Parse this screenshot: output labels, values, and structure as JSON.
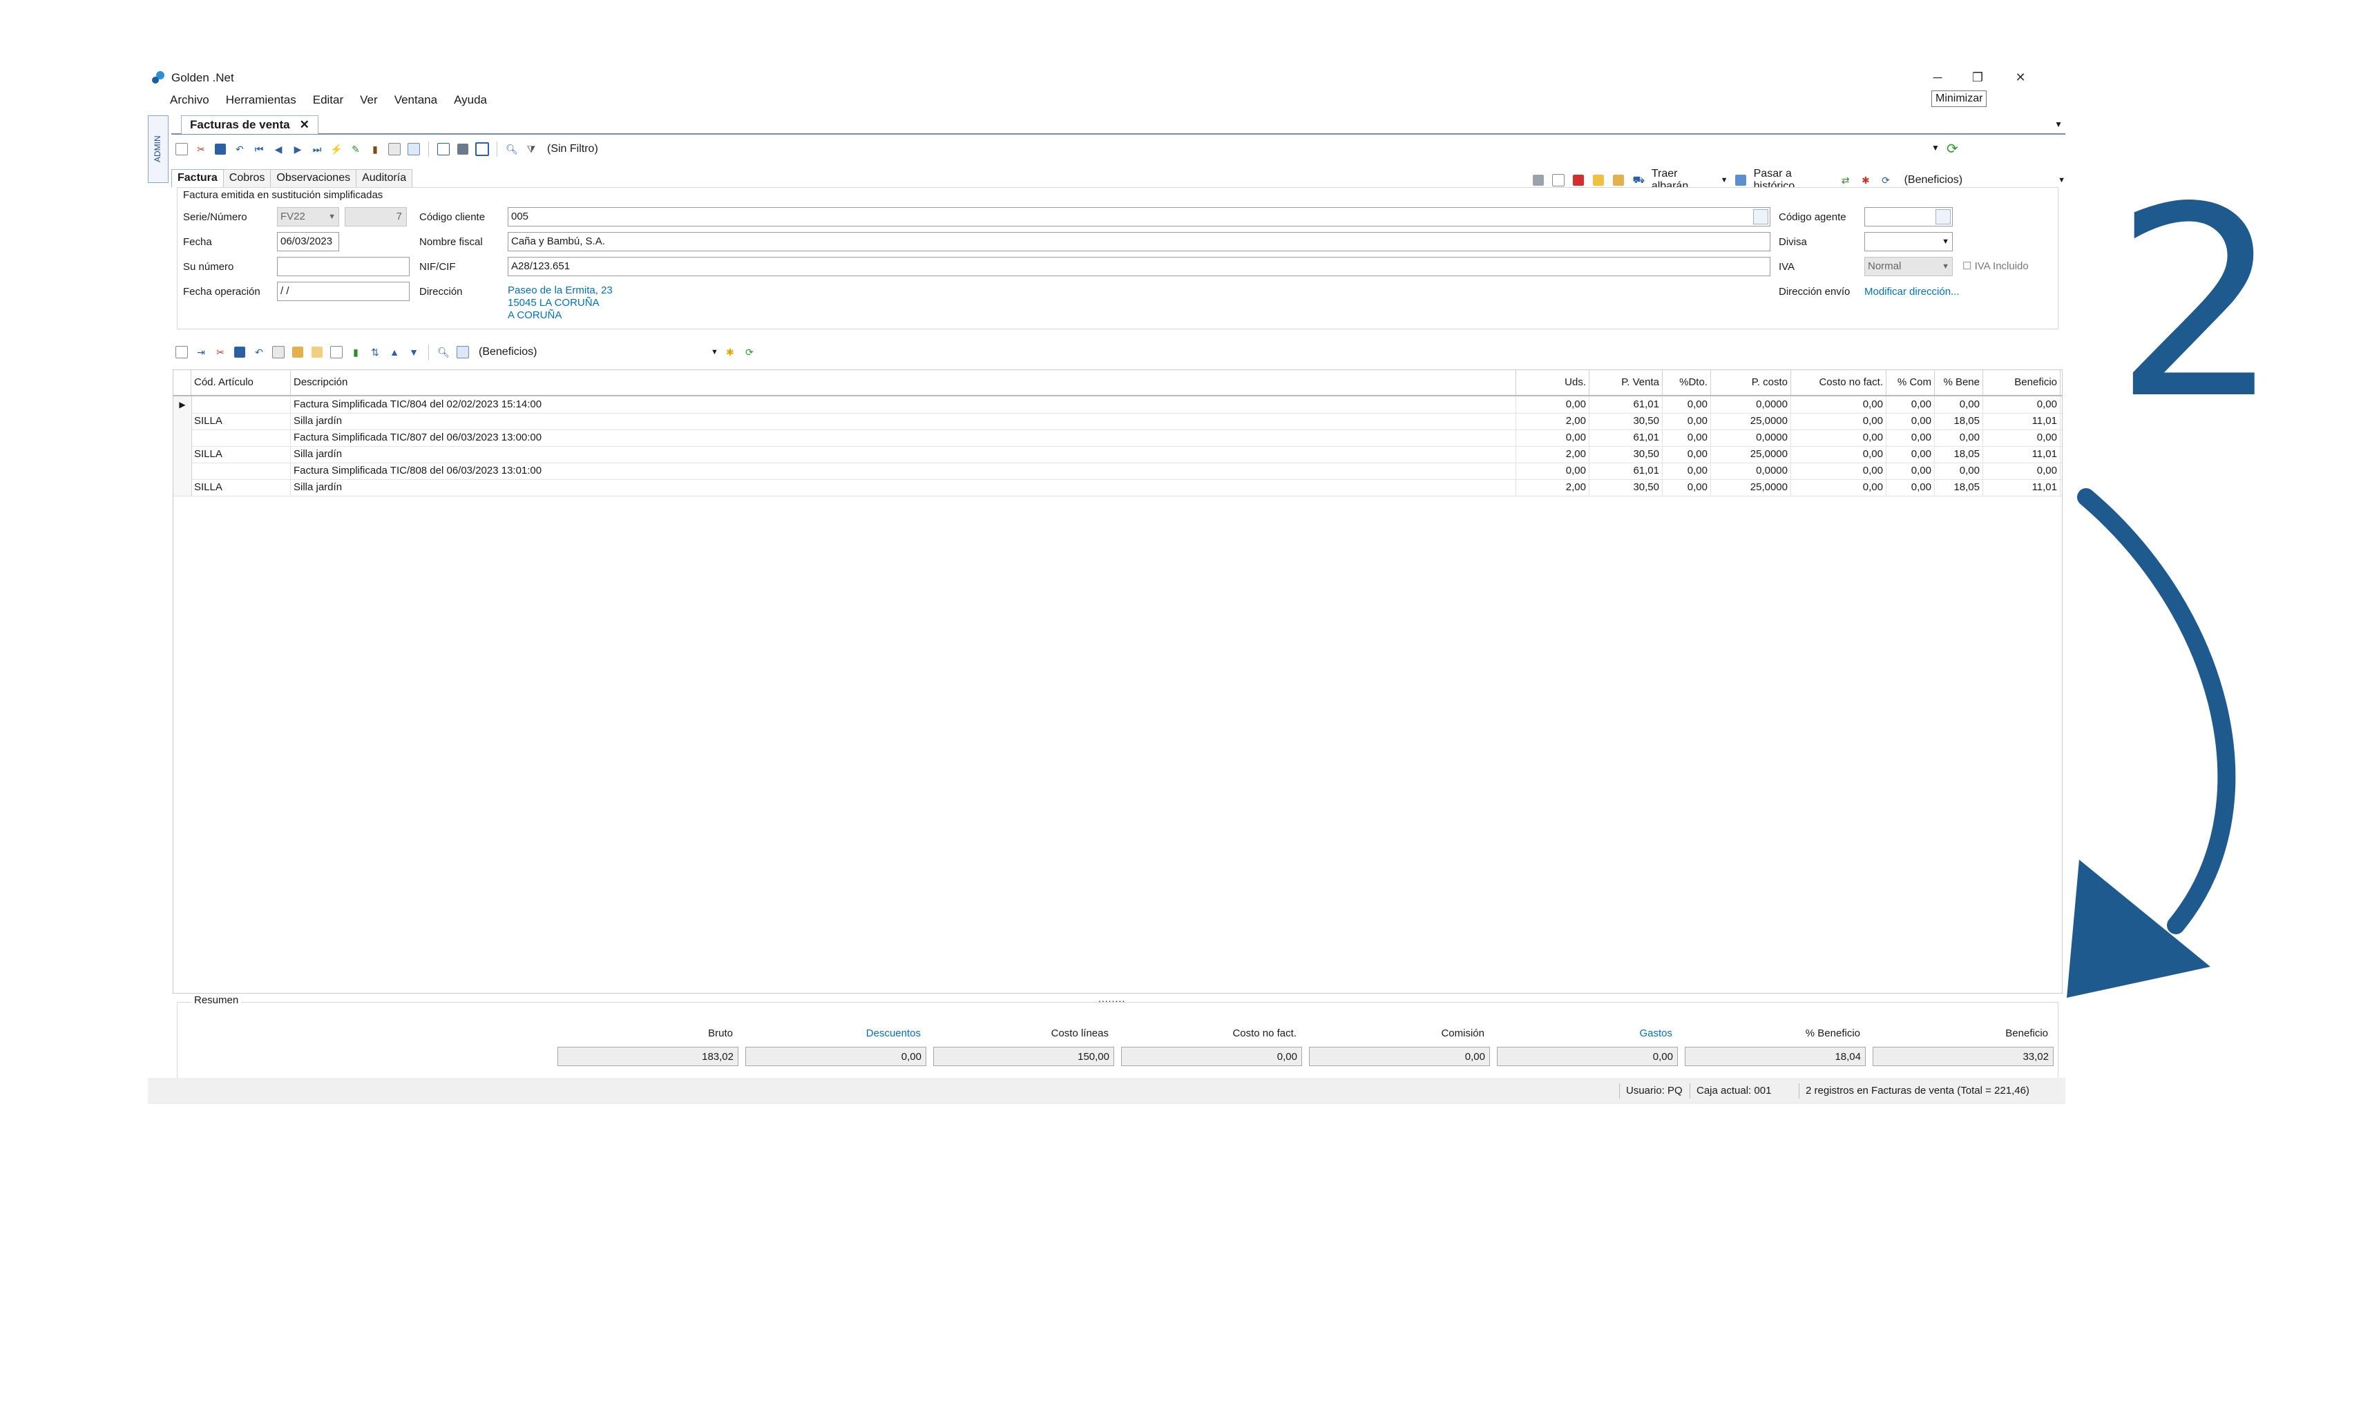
{
  "window": {
    "title": "Golden .Net",
    "tooltip": "Minimizar",
    "controls": {
      "minimize": "─",
      "restore": "❐",
      "close": "✕"
    }
  },
  "menu": [
    "Archivo",
    "Herramientas",
    "Editar",
    "Ver",
    "Ventana",
    "Ayuda"
  ],
  "side_tab": "ADMIN",
  "doc_tab": {
    "label": "Facturas de venta",
    "close": "✕"
  },
  "toolbar": {
    "filter": "(Sin Filtro)"
  },
  "subtabs": [
    "Factura",
    "Cobros",
    "Observaciones",
    "Auditoría"
  ],
  "right_toolbar": {
    "traer": "Traer albarán",
    "pasar": "Pasar a histórico",
    "beneficios": "(Beneficios)"
  },
  "form": {
    "notice": "Factura emitida en sustitución simplificadas",
    "serie_label": "Serie/Número",
    "serie": "FV22",
    "numero": "7",
    "codigo_cliente_label": "Código cliente",
    "codigo_cliente": "005",
    "codigo_agente_label": "Código agente",
    "fecha_label": "Fecha",
    "fecha": "06/03/2023",
    "nombre_fiscal_label": "Nombre fiscal",
    "nombre_fiscal": "Caña y Bambú, S.A.",
    "divisa_label": "Divisa",
    "su_numero_label": "Su número",
    "nif_label": "NIF/CIF",
    "nif": "A28/123.651",
    "iva_label": "IVA",
    "iva": "Normal",
    "iva_incluido": "IVA Incluido",
    "fecha_operacion_label": "Fecha operación",
    "fecha_operacion": " /  /",
    "direccion_label": "Dirección",
    "direccion_lines": [
      "Paseo de la Ermita, 23",
      "15045 LA CORUÑA",
      "A CORUÑA"
    ],
    "direccion_envio_label": "Dirección envío",
    "modificar_direccion": "Modificar dirección..."
  },
  "lines_toolbar": {
    "beneficios": "(Beneficios)"
  },
  "grid": {
    "headers": [
      "Cód. Artículo",
      "Descripción",
      "Uds.",
      "P. Venta",
      "%Dto.",
      "P. costo",
      "Costo no fact.",
      "% Com",
      "% Bene",
      "Beneficio"
    ],
    "rows": [
      [
        "",
        "Factura Simplificada TIC/804 del 02/02/2023 15:14:00",
        "0,00",
        "61,01",
        "0,00",
        "0,0000",
        "0,00",
        "0,00",
        "0,00",
        "0,00"
      ],
      [
        "SILLA",
        "Silla jardín",
        "2,00",
        "30,50",
        "0,00",
        "25,0000",
        "0,00",
        "0,00",
        "18,05",
        "11,01"
      ],
      [
        "",
        "Factura Simplificada TIC/807 del 06/03/2023 13:00:00",
        "0,00",
        "61,01",
        "0,00",
        "0,0000",
        "0,00",
        "0,00",
        "0,00",
        "0,00"
      ],
      [
        "SILLA",
        "Silla jardín",
        "2,00",
        "30,50",
        "0,00",
        "25,0000",
        "0,00",
        "0,00",
        "18,05",
        "11,01"
      ],
      [
        "",
        "Factura Simplificada TIC/808 del 06/03/2023 13:01:00",
        "0,00",
        "61,01",
        "0,00",
        "0,0000",
        "0,00",
        "0,00",
        "0,00",
        "0,00"
      ],
      [
        "SILLA",
        "Silla jardín",
        "2,00",
        "30,50",
        "0,00",
        "25,0000",
        "0,00",
        "0,00",
        "18,05",
        "11,01"
      ]
    ],
    "current_row_marker": "▶"
  },
  "splitter": "........",
  "resumen": {
    "title": "Resumen",
    "headers": [
      "Bruto",
      "Descuentos",
      "Costo líneas",
      "Costo no fact.",
      "Comisión",
      "Gastos",
      "% Beneficio",
      "Beneficio"
    ],
    "values": [
      "183,02",
      "0,00",
      "150,00",
      "0,00",
      "0,00",
      "0,00",
      "18,04",
      "33,02"
    ]
  },
  "status": {
    "usuario": "Usuario: PQ",
    "caja": "Caja actual: 001",
    "registros": "2 registros en Facturas de venta (Total = 221,46)"
  },
  "annotation": {
    "number": "2",
    "color": "#1f5a8f"
  }
}
